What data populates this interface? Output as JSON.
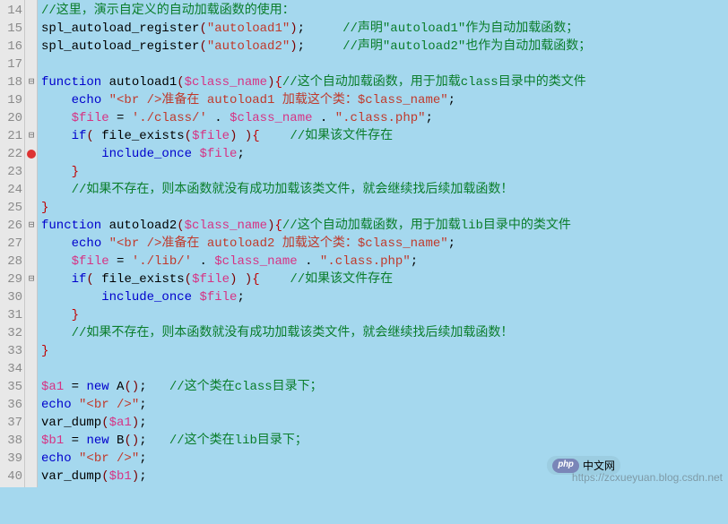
{
  "watermarks": {
    "php_badge": "php",
    "php_text": "中文网",
    "csdn": "https://zcxueyuan.blog.csdn.net"
  },
  "gutter_start": 14,
  "gutter_end": 40,
  "fold_markers": {
    "18": "⊟",
    "21": "⊟",
    "26": "⊟",
    "29": "⊟"
  },
  "breakpoint_line": 22,
  "lines": [
    {
      "n": 14,
      "tokens": [
        {
          "c": "t-comment",
          "t": "//这里，演示自定义的自动加载函数的使用："
        }
      ]
    },
    {
      "n": 15,
      "tokens": [
        {
          "c": "t-id",
          "t": "spl_autoload_register"
        },
        {
          "c": "t-paren",
          "t": "("
        },
        {
          "c": "t-str",
          "t": "\"autoload1\""
        },
        {
          "c": "t-paren",
          "t": ")"
        },
        {
          "c": "t-id",
          "t": ";     "
        },
        {
          "c": "t-comment",
          "t": "//声明\"autoload1\"作为自动加载函数；"
        }
      ]
    },
    {
      "n": 16,
      "tokens": [
        {
          "c": "t-id",
          "t": "spl_autoload_register"
        },
        {
          "c": "t-paren",
          "t": "("
        },
        {
          "c": "t-str",
          "t": "\"autoload2\""
        },
        {
          "c": "t-paren",
          "t": ")"
        },
        {
          "c": "t-id",
          "t": ";     "
        },
        {
          "c": "t-comment",
          "t": "//声明\"autoload2\"也作为自动加载函数；"
        }
      ]
    },
    {
      "n": 17,
      "tokens": []
    },
    {
      "n": 18,
      "tokens": [
        {
          "c": "t-kw",
          "t": "function "
        },
        {
          "c": "t-id",
          "t": "autoload1"
        },
        {
          "c": "t-paren",
          "t": "("
        },
        {
          "c": "t-var",
          "t": "$class_name"
        },
        {
          "c": "t-paren",
          "t": ")"
        },
        {
          "c": "t-brace",
          "t": "{"
        },
        {
          "c": "t-comment",
          "t": "//这个自动加载函数，用于加载class目录中的类文件"
        }
      ]
    },
    {
      "n": 19,
      "indent": "    ",
      "tokens": [
        {
          "c": "t-func",
          "t": "echo "
        },
        {
          "c": "t-str",
          "t": "\"<br />准备在 autoload1 加载这个类：$class_name\""
        },
        {
          "c": "t-id",
          "t": ";"
        }
      ]
    },
    {
      "n": 20,
      "indent": "    ",
      "tokens": [
        {
          "c": "t-var",
          "t": "$file"
        },
        {
          "c": "t-id",
          "t": " = "
        },
        {
          "c": "t-str",
          "t": "'./class/'"
        },
        {
          "c": "t-id",
          "t": " . "
        },
        {
          "c": "t-var",
          "t": "$class_name"
        },
        {
          "c": "t-id",
          "t": " . "
        },
        {
          "c": "t-str",
          "t": "\".class.php\""
        },
        {
          "c": "t-id",
          "t": ";"
        }
      ]
    },
    {
      "n": 21,
      "indent": "    ",
      "tokens": [
        {
          "c": "t-func",
          "t": "if"
        },
        {
          "c": "t-paren",
          "t": "( "
        },
        {
          "c": "t-id",
          "t": "file_exists"
        },
        {
          "c": "t-paren",
          "t": "("
        },
        {
          "c": "t-var",
          "t": "$file"
        },
        {
          "c": "t-paren",
          "t": ") )"
        },
        {
          "c": "t-brace",
          "t": "{"
        },
        {
          "c": "t-id",
          "t": "    "
        },
        {
          "c": "t-comment",
          "t": "//如果该文件存在"
        }
      ]
    },
    {
      "n": 22,
      "indent": "        ",
      "tokens": [
        {
          "c": "t-func",
          "t": "include_once "
        },
        {
          "c": "t-var",
          "t": "$file"
        },
        {
          "c": "t-id",
          "t": ";"
        }
      ]
    },
    {
      "n": 23,
      "indent": "    ",
      "tokens": [
        {
          "c": "t-brace",
          "t": "}"
        }
      ]
    },
    {
      "n": 24,
      "indent": "    ",
      "tokens": [
        {
          "c": "t-comment",
          "t": "//如果不存在，则本函数就没有成功加载该类文件，就会继续找后续加载函数！"
        }
      ]
    },
    {
      "n": 25,
      "tokens": [
        {
          "c": "t-brace",
          "t": "}"
        }
      ]
    },
    {
      "n": 26,
      "tokens": [
        {
          "c": "t-kw",
          "t": "function "
        },
        {
          "c": "t-id",
          "t": "autoload2"
        },
        {
          "c": "t-paren",
          "t": "("
        },
        {
          "c": "t-var",
          "t": "$class_name"
        },
        {
          "c": "t-paren",
          "t": ")"
        },
        {
          "c": "t-brace",
          "t": "{"
        },
        {
          "c": "t-comment",
          "t": "//这个自动加载函数，用于加载lib目录中的类文件"
        }
      ]
    },
    {
      "n": 27,
      "indent": "    ",
      "tokens": [
        {
          "c": "t-func",
          "t": "echo "
        },
        {
          "c": "t-str",
          "t": "\"<br />准备在 autoload2 加载这个类：$class_name\""
        },
        {
          "c": "t-id",
          "t": ";"
        }
      ]
    },
    {
      "n": 28,
      "indent": "    ",
      "tokens": [
        {
          "c": "t-var",
          "t": "$file"
        },
        {
          "c": "t-id",
          "t": " = "
        },
        {
          "c": "t-str",
          "t": "'./lib/'"
        },
        {
          "c": "t-id",
          "t": " . "
        },
        {
          "c": "t-var",
          "t": "$class_name"
        },
        {
          "c": "t-id",
          "t": " . "
        },
        {
          "c": "t-str",
          "t": "\".class.php\""
        },
        {
          "c": "t-id",
          "t": ";"
        }
      ]
    },
    {
      "n": 29,
      "indent": "    ",
      "tokens": [
        {
          "c": "t-func",
          "t": "if"
        },
        {
          "c": "t-paren",
          "t": "( "
        },
        {
          "c": "t-id",
          "t": "file_exists"
        },
        {
          "c": "t-paren",
          "t": "("
        },
        {
          "c": "t-var",
          "t": "$file"
        },
        {
          "c": "t-paren",
          "t": ") )"
        },
        {
          "c": "t-brace",
          "t": "{"
        },
        {
          "c": "t-id",
          "t": "    "
        },
        {
          "c": "t-comment",
          "t": "//如果该文件存在"
        }
      ]
    },
    {
      "n": 30,
      "indent": "        ",
      "tokens": [
        {
          "c": "t-func",
          "t": "include_once "
        },
        {
          "c": "t-var",
          "t": "$file"
        },
        {
          "c": "t-id",
          "t": ";"
        }
      ]
    },
    {
      "n": 31,
      "indent": "    ",
      "tokens": [
        {
          "c": "t-brace",
          "t": "}"
        }
      ]
    },
    {
      "n": 32,
      "indent": "    ",
      "tokens": [
        {
          "c": "t-comment",
          "t": "//如果不存在，则本函数就没有成功加载该类文件，就会继续找后续加载函数！"
        }
      ]
    },
    {
      "n": 33,
      "tokens": [
        {
          "c": "t-brace",
          "t": "}"
        }
      ]
    },
    {
      "n": 34,
      "tokens": []
    },
    {
      "n": 35,
      "tokens": [
        {
          "c": "t-var",
          "t": "$a1"
        },
        {
          "c": "t-id",
          "t": " = "
        },
        {
          "c": "t-kw",
          "t": "new "
        },
        {
          "c": "t-id",
          "t": "A"
        },
        {
          "c": "t-paren",
          "t": "()"
        },
        {
          "c": "t-id",
          "t": ";   "
        },
        {
          "c": "t-comment",
          "t": "//这个类在class目录下；"
        }
      ]
    },
    {
      "n": 36,
      "tokens": [
        {
          "c": "t-func",
          "t": "echo "
        },
        {
          "c": "t-str",
          "t": "\"<br />\""
        },
        {
          "c": "t-id",
          "t": ";"
        }
      ]
    },
    {
      "n": 37,
      "tokens": [
        {
          "c": "t-id",
          "t": "var_dump"
        },
        {
          "c": "t-paren",
          "t": "("
        },
        {
          "c": "t-var",
          "t": "$a1"
        },
        {
          "c": "t-paren",
          "t": ")"
        },
        {
          "c": "t-id",
          "t": ";"
        }
      ]
    },
    {
      "n": 38,
      "tokens": [
        {
          "c": "t-var",
          "t": "$b1"
        },
        {
          "c": "t-id",
          "t": " = "
        },
        {
          "c": "t-kw",
          "t": "new "
        },
        {
          "c": "t-id",
          "t": "B"
        },
        {
          "c": "t-paren",
          "t": "()"
        },
        {
          "c": "t-id",
          "t": ";   "
        },
        {
          "c": "t-comment",
          "t": "//这个类在lib目录下；"
        }
      ]
    },
    {
      "n": 39,
      "tokens": [
        {
          "c": "t-func",
          "t": "echo "
        },
        {
          "c": "t-str",
          "t": "\"<br />\""
        },
        {
          "c": "t-id",
          "t": ";"
        }
      ]
    },
    {
      "n": 40,
      "tokens": [
        {
          "c": "t-id",
          "t": "var_dump"
        },
        {
          "c": "t-paren",
          "t": "("
        },
        {
          "c": "t-var",
          "t": "$b1"
        },
        {
          "c": "t-paren",
          "t": ")"
        },
        {
          "c": "t-id",
          "t": ";"
        }
      ]
    }
  ]
}
